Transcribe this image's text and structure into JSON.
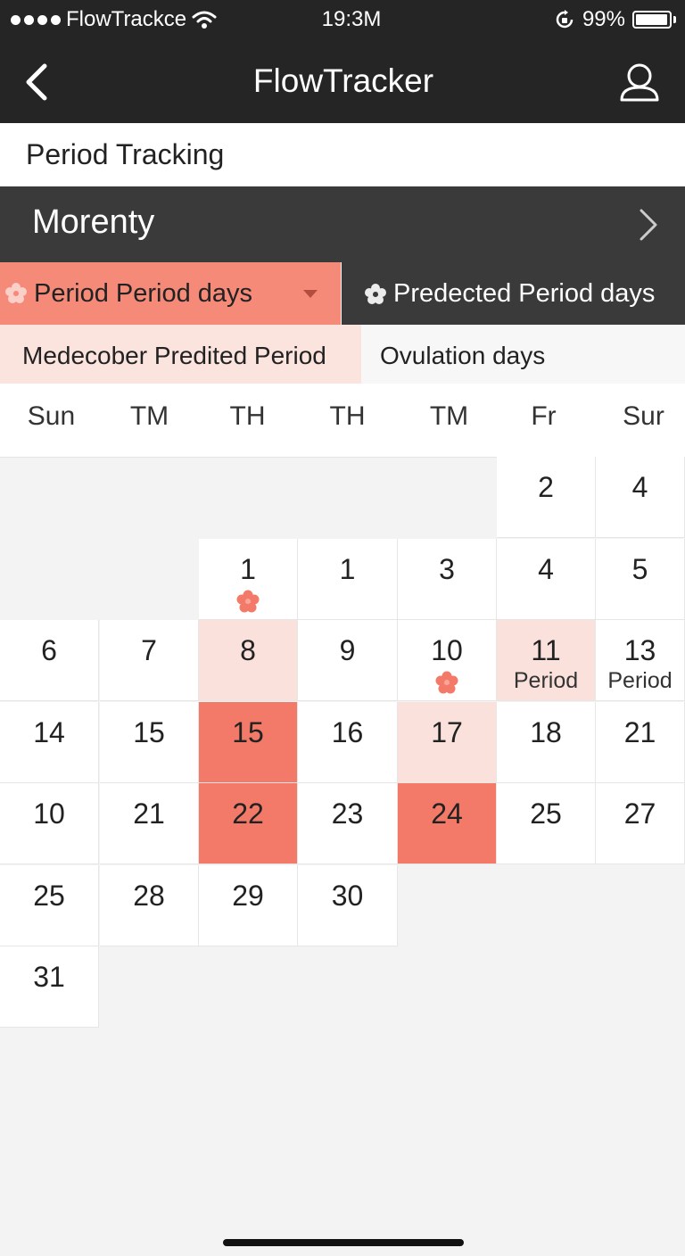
{
  "status_bar": {
    "carrier": "FlowTrackce",
    "time": "19:3M",
    "battery": "99%"
  },
  "nav": {
    "title": "FlowTracker"
  },
  "section_title": "Period Tracking",
  "month": {
    "label": "Morenty"
  },
  "legend": {
    "period_days": "Period Period days",
    "predicted_days": "Predected Period days",
    "medecober": "Medecober Predited Period",
    "ovulation": "Ovulation days"
  },
  "weekdays": [
    "Sun",
    "TM",
    "TH",
    "TH",
    "TM",
    "Fr",
    "Sur"
  ],
  "colors": {
    "period": "#f37a68",
    "predicted": "#fbe1dc",
    "dark_bar": "#252525"
  },
  "calendar": {
    "rows": [
      [
        {
          "col": 5,
          "num": "2"
        },
        {
          "col": 6,
          "num": "4"
        }
      ],
      [
        {
          "col": 2,
          "num": "1",
          "mark": "flower-icon"
        },
        {
          "col": 3,
          "num": "1"
        },
        {
          "col": 4,
          "num": "3"
        },
        {
          "col": 5,
          "num": "4"
        },
        {
          "col": 6,
          "num": "5"
        }
      ],
      [
        {
          "col": 0,
          "num": "6"
        },
        {
          "col": 1,
          "num": "7"
        },
        {
          "col": 2,
          "num": "8",
          "state": "light"
        },
        {
          "col": 3,
          "num": "9"
        },
        {
          "col": 4,
          "num": "10",
          "mark": "flower-icon"
        },
        {
          "col": 5,
          "num": "11",
          "sub": "Period",
          "state": "light"
        },
        {
          "col": 6,
          "num": "13",
          "sub": "Period"
        }
      ],
      [
        {
          "col": 0,
          "num": "14"
        },
        {
          "col": 1,
          "num": "15"
        },
        {
          "col": 2,
          "num": "15",
          "state": "dark"
        },
        {
          "col": 3,
          "num": "16"
        },
        {
          "col": 4,
          "num": "17",
          "state": "light"
        },
        {
          "col": 5,
          "num": "18"
        },
        {
          "col": 6,
          "num": "21"
        }
      ],
      [
        {
          "col": 0,
          "num": "10"
        },
        {
          "col": 1,
          "num": "21"
        },
        {
          "col": 2,
          "num": "22",
          "state": "dark"
        },
        {
          "col": 3,
          "num": "23"
        },
        {
          "col": 4,
          "num": "24",
          "state": "dark"
        },
        {
          "col": 5,
          "num": "25"
        },
        {
          "col": 6,
          "num": "27"
        }
      ],
      [
        {
          "col": 0,
          "num": "25"
        },
        {
          "col": 1,
          "num": "28"
        },
        {
          "col": 2,
          "num": "29"
        },
        {
          "col": 3,
          "num": "30"
        }
      ],
      [
        {
          "col": 0,
          "num": "31"
        }
      ]
    ]
  }
}
